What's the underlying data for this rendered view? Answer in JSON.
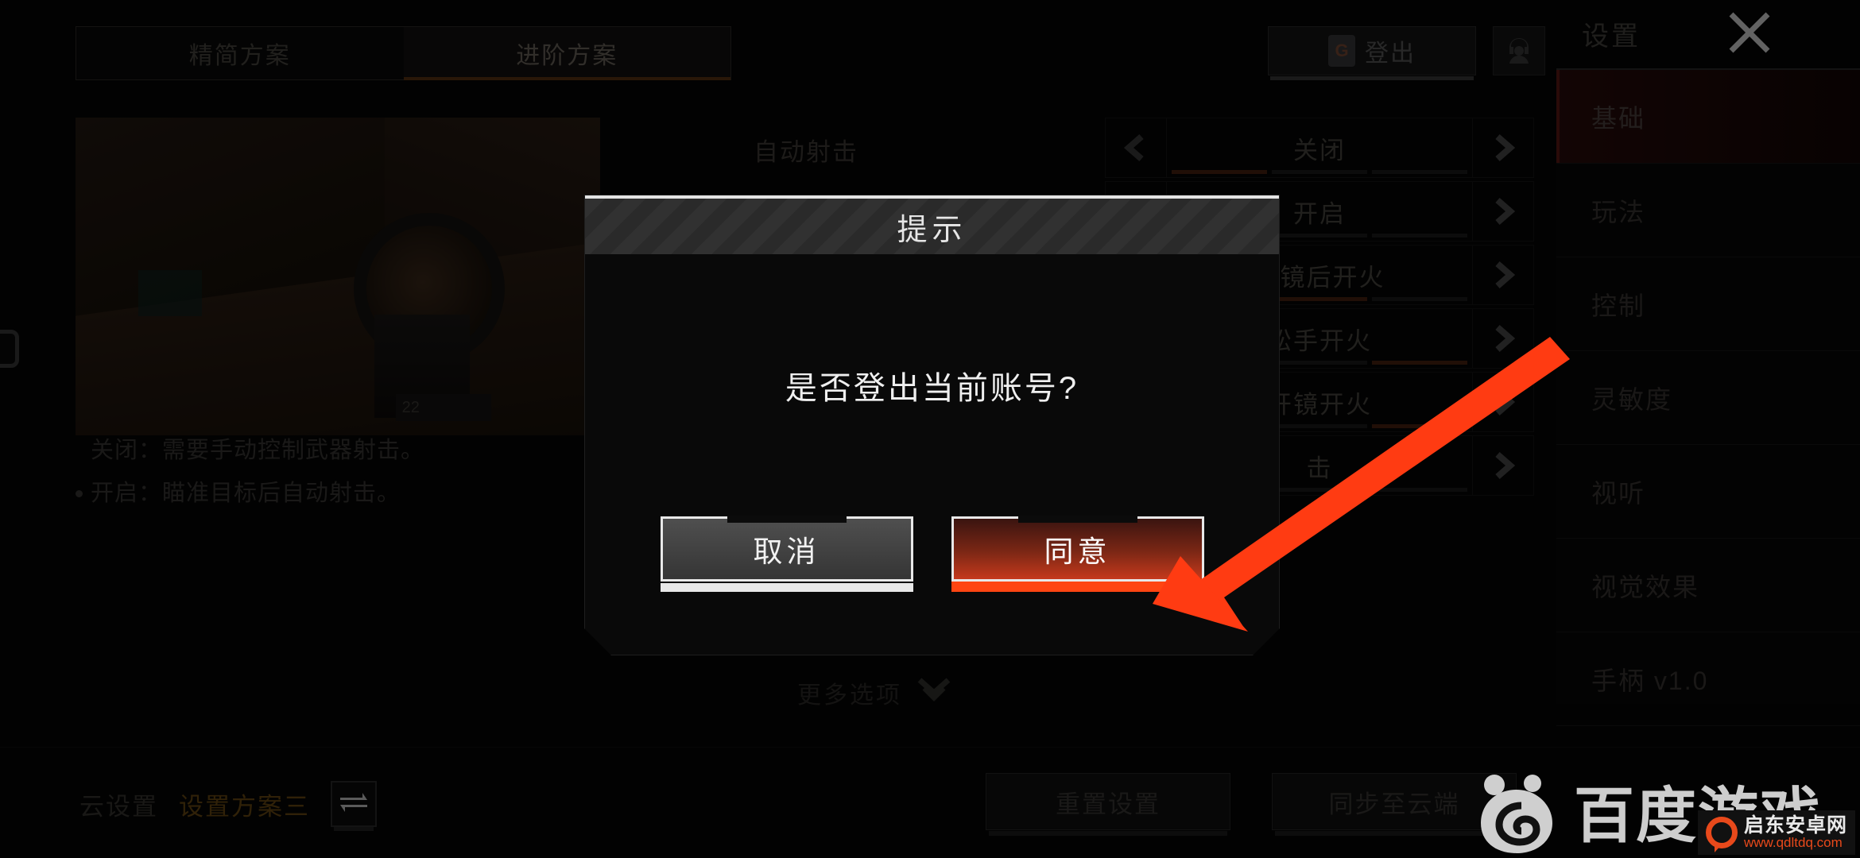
{
  "header": {
    "tabs": [
      {
        "label": "精简方案",
        "active": false
      },
      {
        "label": "进阶方案",
        "active": true
      }
    ],
    "logout_label": "登出",
    "logout_icon": "google-g-icon",
    "support_icon": "headset-icon",
    "panel_title": "设置",
    "close_icon": "close-x-icon"
  },
  "sidebar": {
    "items": [
      {
        "label": "基础",
        "active": true
      },
      {
        "label": "玩法",
        "active": false
      },
      {
        "label": "控制",
        "active": false
      },
      {
        "label": "灵敏度",
        "active": false
      },
      {
        "label": "视听",
        "active": false
      },
      {
        "label": "视觉效果",
        "active": false
      },
      {
        "label": "手柄 v1.0",
        "active": false
      }
    ]
  },
  "preview": {
    "hud_ammo": "22",
    "alt_name": "gameplay-scope-preview"
  },
  "description": {
    "lines": [
      "关闭：需要手动控制武器射击。",
      "开启：瞄准目标后自动射击。"
    ]
  },
  "settings_rows": [
    {
      "label": "自动射击",
      "value": "关闭",
      "segments_on": 1,
      "segments_total": 3
    },
    {
      "label": "",
      "value": "开启",
      "segments_on": 1,
      "segments_total": 3
    },
    {
      "label": "",
      "value": "开镜后开火",
      "segments_on": 1,
      "segments_total": 3
    },
    {
      "label": "",
      "value": "松手开火",
      "segments_on": 1,
      "segments_total": 3
    },
    {
      "label": "",
      "value": "开镜开火",
      "segments_on": 1,
      "segments_total": 3
    },
    {
      "label": "",
      "value": "击",
      "segments_on": 0,
      "segments_total": 3
    }
  ],
  "more_options": {
    "label": "更多选项",
    "icon": "chevron-double-down-icon"
  },
  "bottom_bar": {
    "cloud_label": "云设置",
    "scheme_label": "设置方案三",
    "swap_icon": "swap-arrows-icon",
    "reset_label": "重置设置",
    "sync_label": "同步至云端"
  },
  "dialog": {
    "title": "提示",
    "message": "是否登出当前账号?",
    "cancel_label": "取消",
    "confirm_label": "同意"
  },
  "annotation": {
    "arrow_color": "#FF3B12",
    "arrow_name": "red-pointer-arrow"
  },
  "watermark": {
    "brand": "百度游戏",
    "bear_icon": "baidu-bear-icon",
    "site_name": "启东安卓网",
    "site_url": "www.qdltdq.com"
  },
  "colors": {
    "accent_orange": "#FF4512",
    "active_tab_underline": "#5C3312",
    "sidebar_active_bg": "#2A0D0C",
    "scheme_amber": "#6A4A13"
  }
}
